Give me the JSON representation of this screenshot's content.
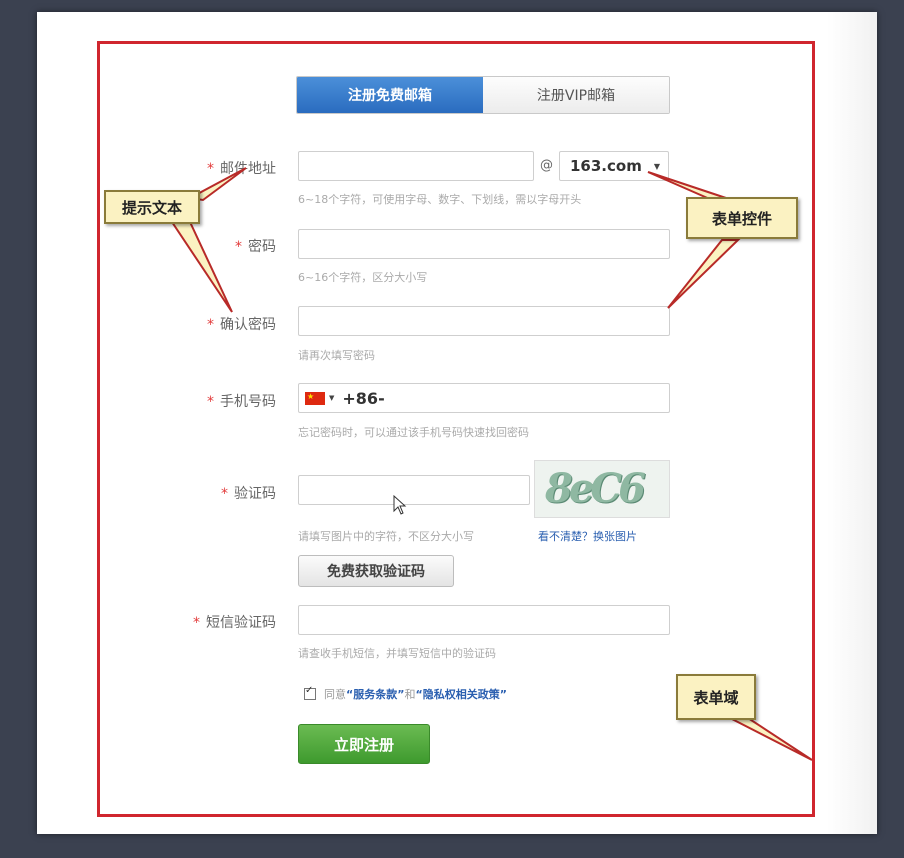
{
  "tabs": {
    "free": "注册免费邮箱",
    "vip": "注册VIP邮箱"
  },
  "required_mark": "*",
  "fields": {
    "email": {
      "label": "邮件地址",
      "value": "",
      "hint": "6~18个字符，可使用字母、数字、下划线，需以字母开头"
    },
    "at_symbol": "@",
    "domain": {
      "value": "163.com"
    },
    "password": {
      "label": "密码",
      "value": "",
      "hint": "6~16个字符，区分大小写"
    },
    "confirm_password": {
      "label": "确认密码",
      "value": "",
      "hint": "请再次填写密码"
    },
    "phone": {
      "label": "手机号码",
      "prefix": "+86-",
      "hint": "忘记密码时，可以通过该手机号码快速找回密码"
    },
    "captcha": {
      "label": "验证码",
      "value": "",
      "hint": "请填写图片中的字符，不区分大小写",
      "image_text": "8eC6",
      "refresh_link": "看不清楚？换张图片"
    },
    "sms_button": "免费获取验证码",
    "sms_code": {
      "label": "短信验证码",
      "value": "",
      "hint": "请查收手机短信，并填写短信中的验证码"
    }
  },
  "agreement": {
    "checked": true,
    "prefix": "同意",
    "terms": "“服务条款”",
    "and": "和",
    "privacy": "“隐私权相关政策”"
  },
  "submit_label": "立即注册",
  "callouts": {
    "hint_text": "提示文本",
    "form_control": "表单控件",
    "form_field": "表单域"
  },
  "colors": {
    "frame": "#d0262e",
    "tab_active": "#2a6cbf",
    "submit": "#4aa236",
    "callout_bg": "#fbf2c2",
    "link": "#2a5fb0"
  }
}
